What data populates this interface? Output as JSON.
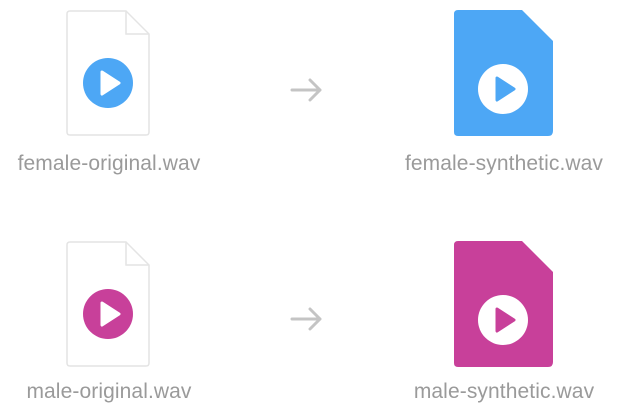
{
  "colors": {
    "female_accent": "#4DA7F5",
    "male_accent": "#C8409A",
    "label_text": "#9a9a9a",
    "arrow": "#c4c4c4",
    "blank_file_fill": "#ffffff",
    "blank_file_border": "#e4e4e4"
  },
  "rows": [
    {
      "original": {
        "filename": "female-original.wav",
        "icon": "audio-file-play-icon"
      },
      "arrow_icon": "right-arrow-icon",
      "synthetic": {
        "filename": "female-synthetic.wav",
        "icon": "audio-file-play-icon"
      }
    },
    {
      "original": {
        "filename": "male-original.wav",
        "icon": "audio-file-play-icon"
      },
      "arrow_icon": "right-arrow-icon",
      "synthetic": {
        "filename": "male-synthetic.wav",
        "icon": "audio-file-play-icon"
      }
    }
  ]
}
